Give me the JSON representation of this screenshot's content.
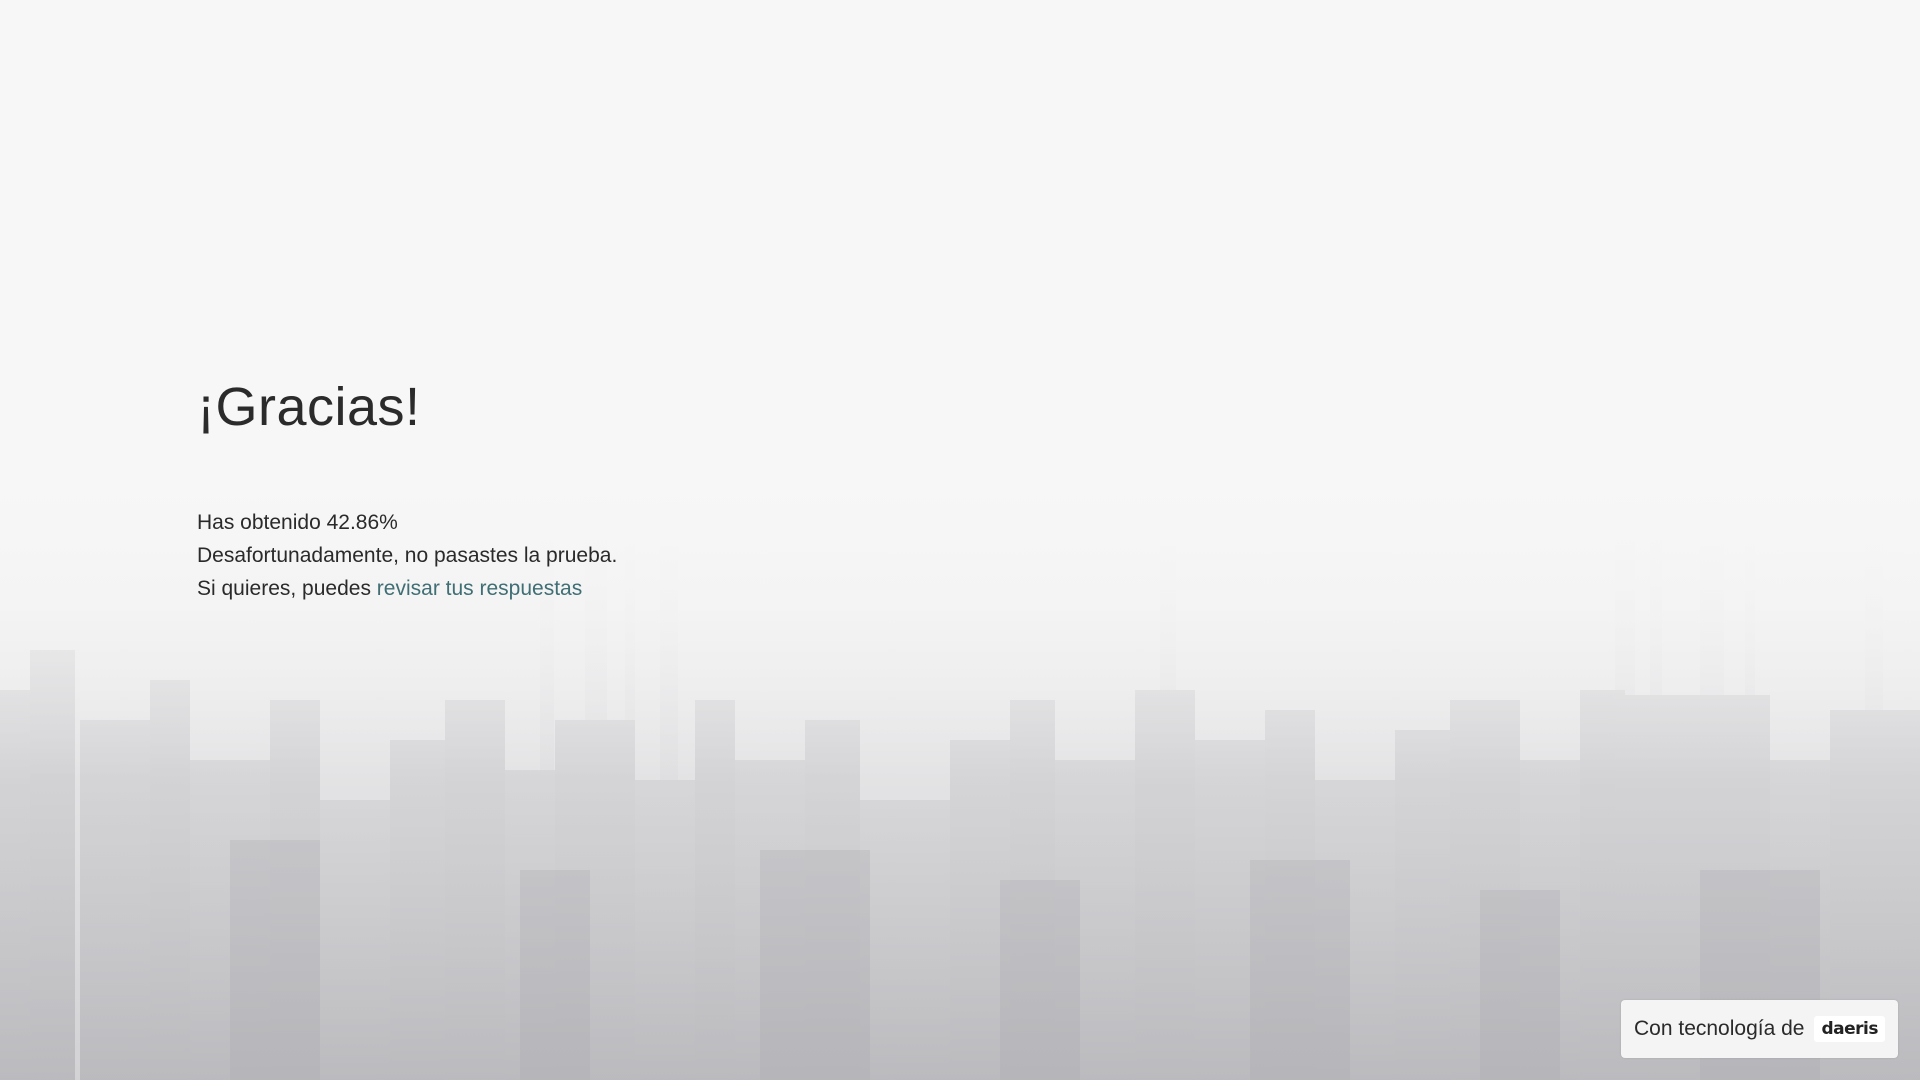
{
  "page": {
    "title": "¡Gracias!",
    "score_line": "Has obtenido 42.86%",
    "result_line": "Desafortunadamente, no pasastes la prueba.",
    "review_prefix": "Si quieres, puedes ",
    "review_link": "revisar tus respuestas"
  },
  "footer": {
    "powered_by": "Con tecnología de",
    "logo_text": "daeris"
  },
  "colors": {
    "link": "#3f6e74",
    "text": "#2a2a2a",
    "background": "#f6f6f6"
  },
  "background_image": "city-skyline-fog"
}
